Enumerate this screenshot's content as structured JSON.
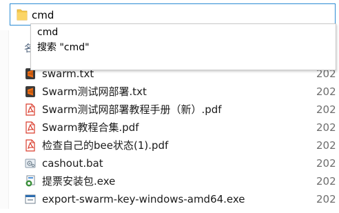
{
  "address_bar": {
    "value": "cmd",
    "folder_icon": "folder-icon"
  },
  "suggestions": [
    {
      "label": "cmd"
    },
    {
      "label": "搜索 \"cmd\""
    }
  ],
  "column_header": "名",
  "files": [
    {
      "name": "swarm.txt",
      "icon": "sublime-text-icon",
      "date": "202"
    },
    {
      "name": "Swarm测试网部署.txt",
      "icon": "sublime-text-icon",
      "date": "202"
    },
    {
      "name": "Swarm测试网部署教程手册（新）.pdf",
      "icon": "pdf-icon",
      "date": "202"
    },
    {
      "name": "Swarm教程合集.pdf",
      "icon": "pdf-icon",
      "date": "202"
    },
    {
      "name": "检查自己的bee状态(1).pdf",
      "icon": "pdf-icon",
      "date": "202"
    },
    {
      "name": "cashout.bat",
      "icon": "batch-file-icon",
      "date": "202"
    },
    {
      "name": "提票安装包.exe",
      "icon": "installer-icon",
      "date": "202"
    },
    {
      "name": "export-swarm-key-windows-amd64.exe",
      "icon": "exe-icon",
      "date": "202"
    }
  ],
  "colors": {
    "focus_border": "#2a8ad4",
    "folder_yellow": "#f5c84c",
    "pdf_red": "#d93b2b",
    "sublime_orange": "#ef6c13"
  }
}
